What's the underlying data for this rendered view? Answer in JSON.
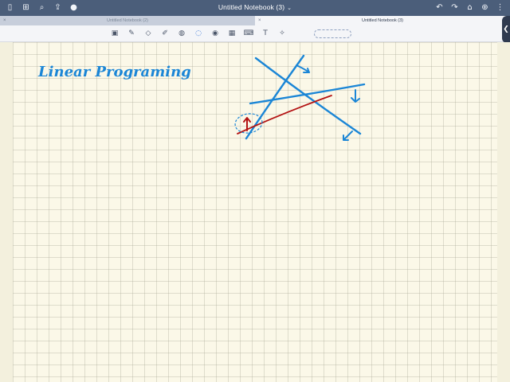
{
  "window": {
    "title": "Untitled Notebook (3)"
  },
  "tabs": [
    {
      "label": "Untitled Notebook (2)",
      "active": false
    },
    {
      "label": "Untitled Notebook (3)",
      "active": true
    }
  ],
  "toolbar": {
    "tools": [
      "image-panel-icon",
      "pen-icon",
      "eraser-icon",
      "highlighter-icon",
      "shapes-icon",
      "lasso-icon",
      "camera-icon",
      "photo-icon",
      "keyboard-icon",
      "text-icon",
      "laser-pointer-icon"
    ]
  },
  "canvas": {
    "heading": "Linear Programing",
    "ink_colors": {
      "blue": "#1b86d6",
      "red": "#b31212"
    }
  }
}
